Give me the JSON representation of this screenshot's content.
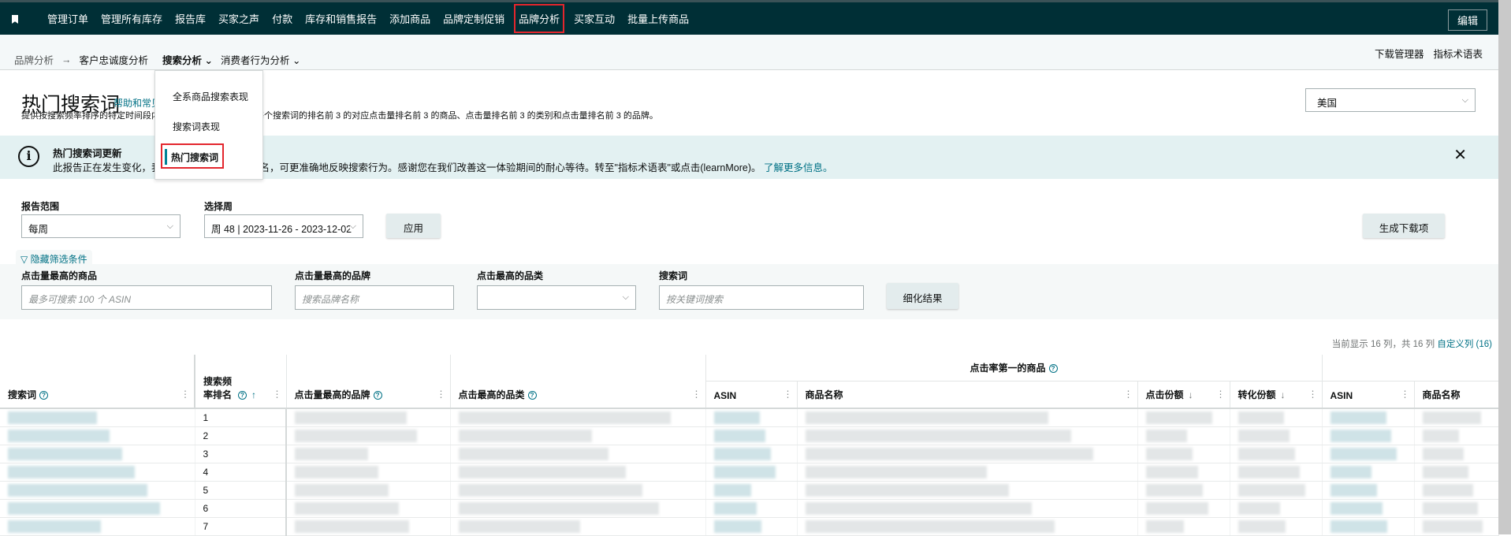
{
  "topnav": {
    "items": [
      "管理订单",
      "管理所有库存",
      "报告库",
      "买家之声",
      "付款",
      "库存和销售报告",
      "添加商品",
      "品牌定制促销",
      "品牌分析",
      "买家互动",
      "批量上传商品"
    ],
    "highlighted_index": 8,
    "edit": "编辑"
  },
  "subnav": {
    "breadcrumb_root": "品牌分析",
    "arrow": "→",
    "items": [
      "客户忠诚度分析",
      "搜索分析",
      "消费者行为分析"
    ],
    "right": [
      "下载管理器",
      "指标术语表"
    ]
  },
  "dropdown": {
    "items": [
      "全系商品搜索表现",
      "搜索词表现",
      "热门搜索词"
    ],
    "selected_index": 2
  },
  "page": {
    "title": "热门搜索词",
    "help": "帮助和常见",
    "description": "提供按搜索频率排序的特定时间段内搜索词的报告，它显示了每个搜索词的排名前 3 的对应点击量排名前 3 的商品、点击量排名前 3 的类别和点击量排名前 3 的品牌。",
    "country": "美国"
  },
  "banner": {
    "title": "热门搜索词更新",
    "message": "此报告正在发生变化，我们正在改进搜索频率排名，可更准确地反映搜索行为。感谢您在我们改善这一体验期间的耐心等待。转至\"指标术语表\"或点击(learnMore)。",
    "link": "了解更多信息。"
  },
  "filters": {
    "range_label": "报告范围",
    "range_value": "每周",
    "week_label": "选择周",
    "week_value": "周 48 | 2023-11-26 - 2023-12-02",
    "apply": "应用",
    "generate": "生成下载项",
    "hide": "隐藏筛选条件",
    "product_label": "点击量最高的商品",
    "product_placeholder": "最多可搜索 100 个 ASIN",
    "brand_label": "点击量最高的品牌",
    "brand_placeholder": "搜索品牌名称",
    "category_label": "点击最高的品类",
    "category_value": "",
    "term_label": "搜索词",
    "term_placeholder": "按关键词搜索",
    "refine": "细化结果"
  },
  "table": {
    "count_text": "当前显示 16 列，共 16 列",
    "customize": "自定义列 (16)",
    "group_header": "点击率第一的商品",
    "headers": [
      "搜索词",
      "搜索频率排名",
      "点击量最高的品牌",
      "点击最高的品类",
      "ASIN",
      "商品名称",
      "点击份额",
      "转化份额",
      "ASIN",
      "商品名称"
    ],
    "ranks": [
      "1",
      "2",
      "3",
      "4",
      "5",
      "6",
      "7"
    ]
  },
  "colors": {
    "topbar": "#002f36",
    "accent": "#008296",
    "link": "#007185",
    "highlight": "#e3262d",
    "banner": "#e3f1f2"
  }
}
